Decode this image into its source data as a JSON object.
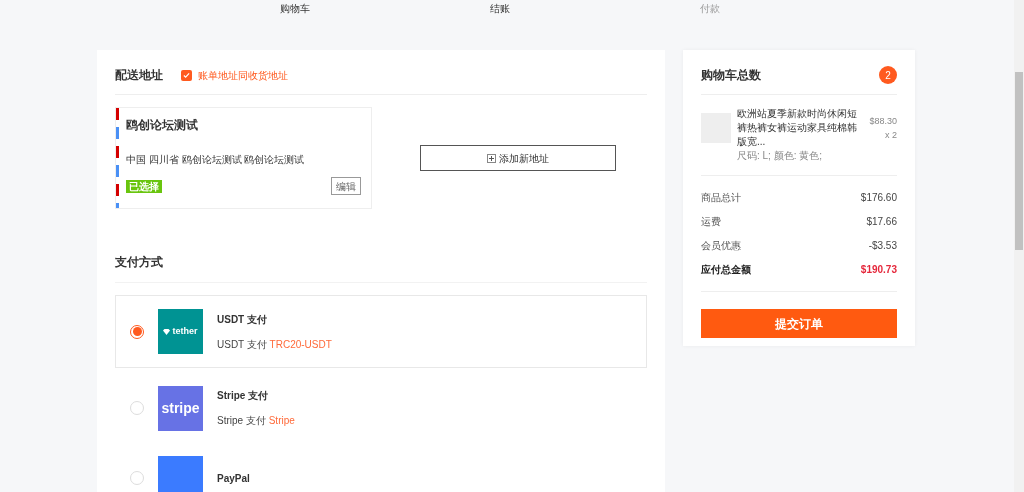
{
  "steps": [
    {
      "label": "购物车",
      "done": true
    },
    {
      "label": "结账",
      "done": true
    },
    {
      "label": "付款",
      "done": false
    }
  ],
  "shipping": {
    "title": "配送地址",
    "same_billing": {
      "label": "账单地址同收货地址",
      "checked": true
    },
    "address": {
      "name": "鸥创论坛测试",
      "line": "中国 四川省 鸥创论坛测试 鸥创论坛测试",
      "badge": "已选择",
      "selected": true,
      "edit": "编辑"
    },
    "add_button": "添加新地址"
  },
  "payment": {
    "title": "支付方式",
    "methods": [
      {
        "kind": "tether",
        "logo_text": "tether",
        "title": "USDT 支付",
        "desc": "USDT 支付",
        "highlight": "TRC20-USDT",
        "selected": true
      },
      {
        "kind": "stripe",
        "logo_text": "stripe",
        "title": "Stripe 支付",
        "desc": "Stripe 支付",
        "highlight": "Stripe",
        "selected": false
      },
      {
        "kind": "paypal",
        "title": "PayPal",
        "selected": false
      }
    ]
  },
  "cart": {
    "title": "购物车总数",
    "count": "2",
    "item": {
      "name": "欧洲站夏季新款时尚休闲短裤热裤女裤运动家具纯棉韩版宽...",
      "price": "$88.30",
      "qty": "x 2",
      "options": "尺码: L; 颜色: 黄色;"
    },
    "totals": [
      {
        "label": "商品总计",
        "value": "$176.60",
        "kind": "normal"
      },
      {
        "label": "运费",
        "value": "$17.66",
        "kind": "normal"
      },
      {
        "label": "会员优惠",
        "value": "-$3.53",
        "kind": "normal"
      },
      {
        "label": "应付总金额",
        "value": "$190.73",
        "kind": "total"
      }
    ],
    "submit": "提交订单"
  }
}
